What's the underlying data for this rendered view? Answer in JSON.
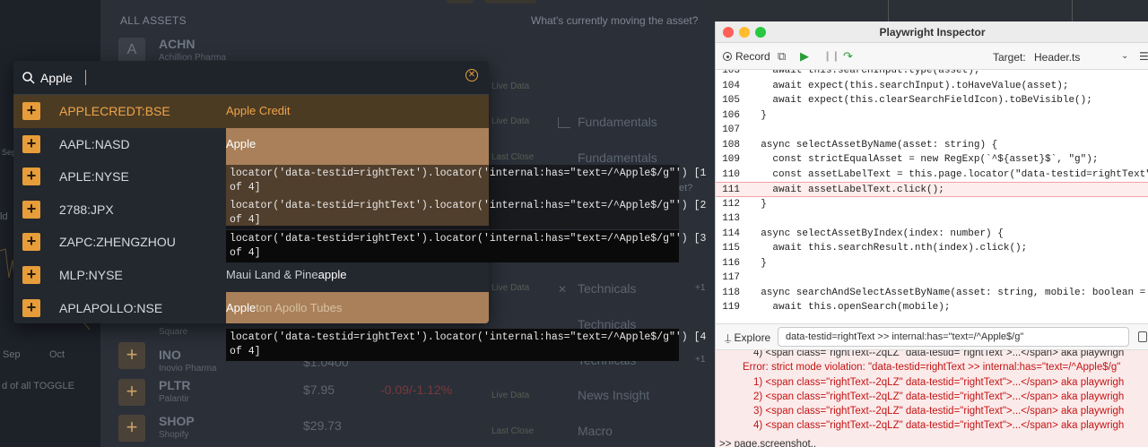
{
  "app": {
    "section_title": "ALL ASSETS",
    "section_prompt": "What's currently moving the asset?",
    "bg_rows": [
      {
        "ticker": "ACHN",
        "name": "Achillion Pharma",
        "price": "",
        "change": "",
        "badge": "A"
      },
      {
        "ticker": "INO",
        "name": "Inovio Pharma",
        "price": "$1.0400",
        "change": "",
        "badge": "+"
      },
      {
        "ticker": "PLTR",
        "name": "Palantir",
        "price": "$7.95",
        "change": "-0.09/-1.12%",
        "badge": "+"
      },
      {
        "ticker": "SHOP",
        "name": "Shopify",
        "price": "$29.73",
        "change": "",
        "badge": "+"
      }
    ],
    "bg_tags": [
      "Live Data",
      "Live Data",
      "Last Close",
      "Live Data",
      "Live Data",
      "Last Close"
    ],
    "bg_categories": [
      "Fundamentals",
      "Fundamentals",
      "Technicals",
      "Technicals",
      "Technicals",
      "News Insight",
      "Macro"
    ],
    "square_label": "Square",
    "left_labels": [
      "Sep",
      "Oct",
      "d of all TOGGLE",
      "ld",
      "Sep",
      "+1",
      "+1",
      "et?"
    ]
  },
  "search": {
    "value": "Apple",
    "results": [
      {
        "symbol": "APPLECREDT:BSE",
        "match": "Apple",
        "rest": " Credit"
      },
      {
        "symbol": "AAPL:NASD",
        "match": "Apple",
        "rest": ""
      },
      {
        "symbol": "APLE:NYSE",
        "match": "",
        "rest": ""
      },
      {
        "symbol": "2788:JPX",
        "match": "",
        "rest": ""
      },
      {
        "symbol": "ZAPC:ZHENGZHOU",
        "match": "",
        "rest": ""
      },
      {
        "symbol": "MLP:NYSE",
        "pre": "Maui Land & Pine",
        "match": "apple",
        "rest": ""
      },
      {
        "symbol": "APLAPOLLO:NSE",
        "match": "Apple",
        "rest": "ton Apollo Tubes"
      }
    ]
  },
  "locators": [
    "locator('data-testid=rightText').locator('internal:has=\"text=/^Apple$/g\"') [1\nof 4]",
    "locator('data-testid=rightText').locator('internal:has=\"text=/^Apple$/g\"') [2\nof 4]",
    "locator('data-testid=rightText').locator('internal:has=\"text=/^Apple$/g\"') [3\nof 4]",
    "locator('data-testid=rightText').locator('internal:has=\"text=/^Apple$/g\"') [4\nof 4]"
  ],
  "inspector": {
    "title": "Playwright Inspector",
    "record_label": "Record",
    "target_label": "Target:",
    "target_value": "Header.ts",
    "explore_label": "Explore",
    "explore_value": "data-testid=rightText >> internal:has=\"text=/^Apple$/g\"",
    "code_lines": [
      {
        "no": "103",
        "text": "    await this.searchInput.type(asset);"
      },
      {
        "no": "104",
        "text": "    await expect(this.searchInput).toHaveValue(asset);"
      },
      {
        "no": "105",
        "text": "    await expect(this.clearSearchFieldIcon).toBeVisible();"
      },
      {
        "no": "106",
        "text": "  }"
      },
      {
        "no": "107",
        "text": ""
      },
      {
        "no": "108",
        "text": "  async selectAssetByName(asset: string) {"
      },
      {
        "no": "109",
        "text": "    const strictEqualAsset = new RegExp(`^${asset}$`, \"g\");"
      },
      {
        "no": "110",
        "text": "    const assetLabelText = this.page.locator(\"data-testid=rightText\", { has"
      },
      {
        "no": "111",
        "text": "    await assetLabelText.click();"
      },
      {
        "no": "112",
        "text": "  }"
      },
      {
        "no": "113",
        "text": ""
      },
      {
        "no": "114",
        "text": "  async selectAssetByIndex(index: number) {"
      },
      {
        "no": "115",
        "text": "    await this.searchResult.nth(index).click();"
      },
      {
        "no": "116",
        "text": "  }"
      },
      {
        "no": "117",
        "text": ""
      },
      {
        "no": "118",
        "text": "  async searchAndSelectAssetByName(asset: string, mobile: boolean = false)"
      },
      {
        "no": "119",
        "text": "    await this.openSearch(mobile);"
      }
    ],
    "console_lines": [
      "4) <span class=\"rightText--2qLZ\" data-testid=\"rightText\">...</span> aka playwrigh",
      "Error: strict mode violation: \"data-testid=rightText >> internal:has=\"text=/^Apple$/g\"",
      "1) <span class=\"rightText--2qLZ\" data-testid=\"rightText\">...</span> aka playwrigh",
      "2) <span class=\"rightText--2qLZ\" data-testid=\"rightText\">...</span> aka playwrigh",
      "3) <span class=\"rightText--2qLZ\" data-testid=\"rightText\">...</span> aka playwrigh",
      "4) <span class=\"rightText--2qLZ\" data-testid=\"rightText\">...</span> aka playwrigh",
      ">> page.screenshot.."
    ]
  },
  "colors": {
    "accent": "#e69d3a",
    "highlight": "#a9805a",
    "error": "#c41414"
  }
}
